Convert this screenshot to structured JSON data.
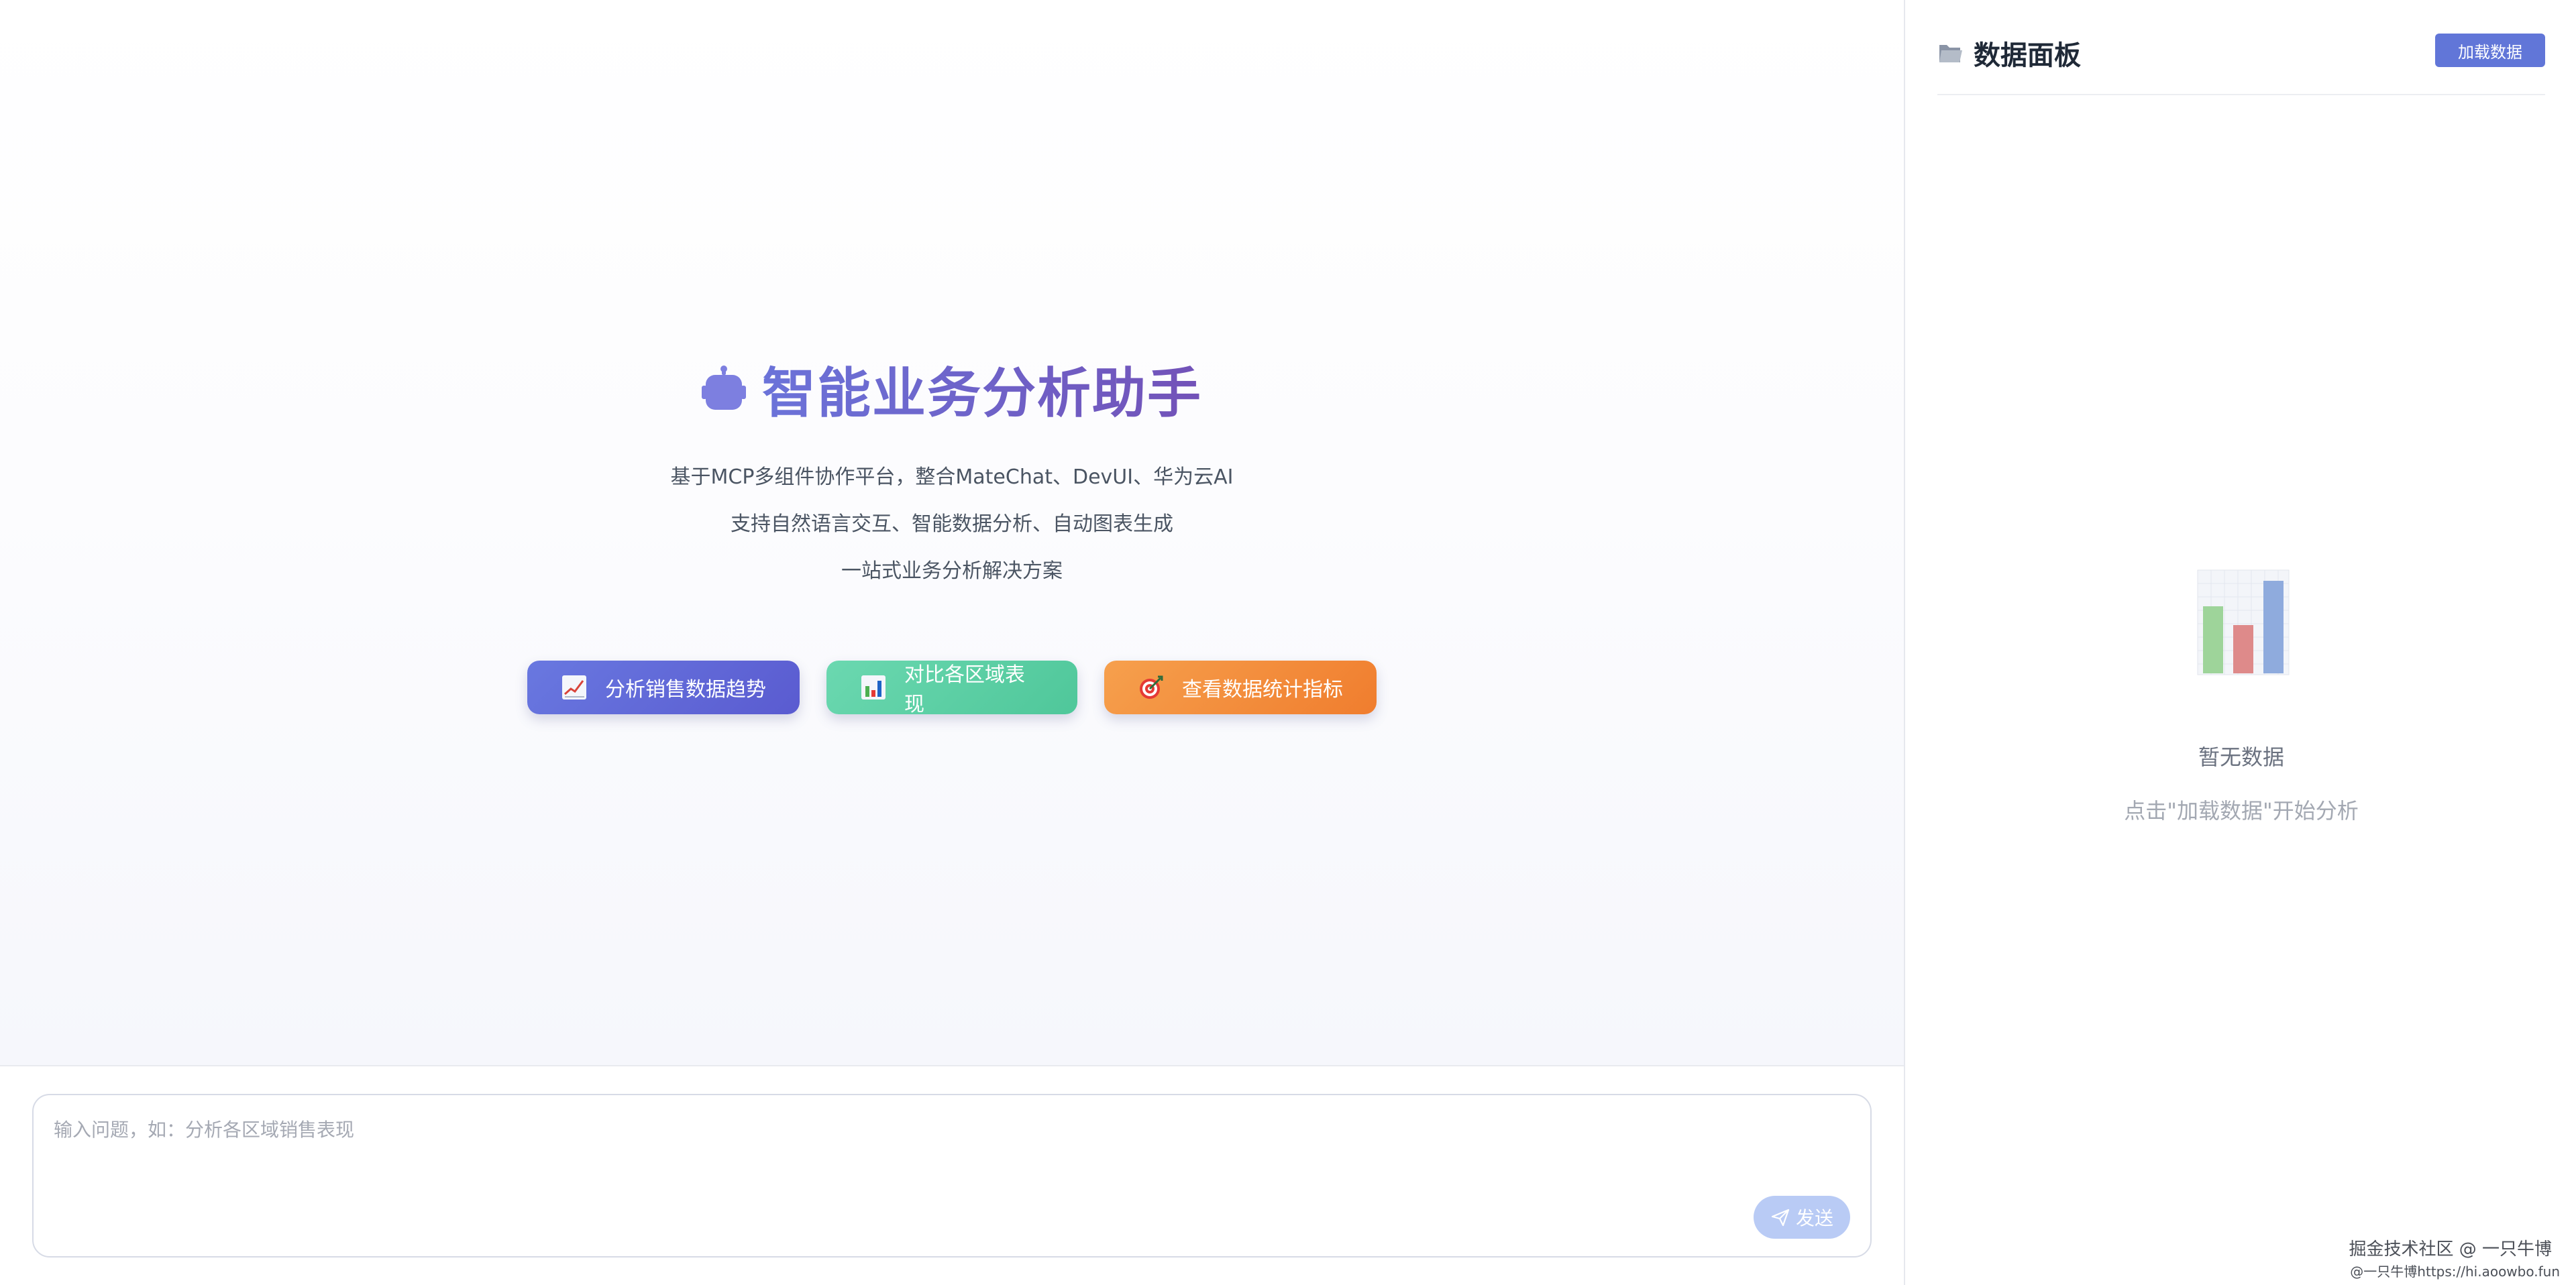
{
  "hero": {
    "title": "智能业务分析助手",
    "lines": [
      "基于MCP多组件协作平台，整合MateChat、DevUI、华为云AI",
      "支持自然语言交互、智能数据分析、自动图表生成",
      "一站式业务分析解决方案"
    ],
    "quick_actions": [
      {
        "label": "分析销售数据趋势",
        "icon": "chart-increasing-icon",
        "color": "#5f68d6"
      },
      {
        "label": "对比各区域表现",
        "icon": "bar-chart-icon",
        "color": "#5ccfa4"
      },
      {
        "label": "查看数据统计指标",
        "icon": "target-icon",
        "color": "#f38a38"
      }
    ]
  },
  "composer": {
    "placeholder": "输入问题，如：分析各区域销售表现",
    "send_label": "发送",
    "send_icon": "paper-plane-icon"
  },
  "panel": {
    "title": "数据面板",
    "title_icon": "folder-icon",
    "load_button": "加载数据",
    "empty_icon": "bar-chart-icon",
    "empty_title": "暂无数据",
    "empty_hint": "点击\"加载数据\"开始分析"
  },
  "footer": {
    "line1": "掘金技术社区 @ 一只牛博",
    "line2": "@一只牛博https://hi.aoowbo.fun"
  },
  "colors": {
    "accent": "#6176d8",
    "title_gradient_start": "#6b73d9",
    "title_gradient_end": "#7252b8"
  }
}
